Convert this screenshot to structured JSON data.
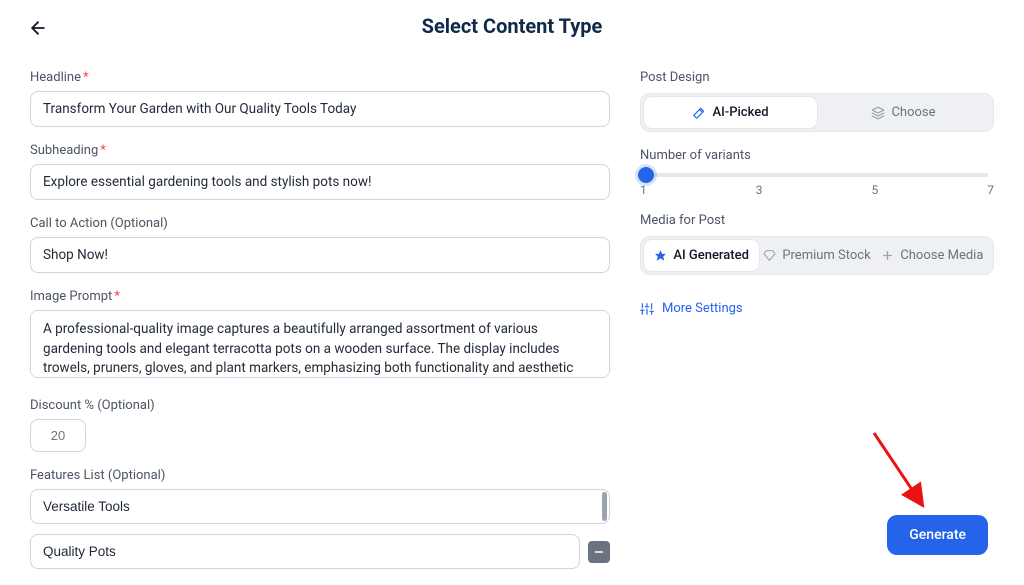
{
  "header": {
    "title": "Select Content Type"
  },
  "form": {
    "headline": {
      "label": "Headline",
      "required": true,
      "value": "Transform Your Garden with Our Quality Tools Today"
    },
    "subheading": {
      "label": "Subheading",
      "required": true,
      "value": "Explore essential gardening tools and stylish pots now!"
    },
    "cta": {
      "label": "Call to Action (Optional)",
      "value": "Shop Now!"
    },
    "image_prompt": {
      "label": "Image Prompt",
      "required": true,
      "value": "A professional-quality image captures a beautifully arranged assortment of various gardening tools and elegant terracotta pots on a wooden surface. The display includes trowels, pruners, gloves, and plant markers, emphasizing both functionality and aesthetic appeal, surrounded"
    },
    "discount": {
      "label": "Discount % (Optional)",
      "placeholder": "20"
    },
    "features": {
      "label": "Features List (Optional)",
      "items": [
        {
          "value": "Versatile Tools"
        },
        {
          "value": "Quality Pots"
        }
      ]
    }
  },
  "sidebar": {
    "post_design": {
      "label": "Post Design",
      "options": [
        "AI-Picked",
        "Choose"
      ],
      "selected_index": 0
    },
    "variants": {
      "label": "Number of variants",
      "ticks": [
        "1",
        "3",
        "5",
        "7"
      ],
      "value": 1
    },
    "media": {
      "label": "Media for Post",
      "options": [
        "AI Generated",
        "Premium Stock",
        "Choose Media"
      ],
      "selected_index": 0
    },
    "more_settings_label": "More Settings"
  },
  "actions": {
    "generate_label": "Generate"
  }
}
